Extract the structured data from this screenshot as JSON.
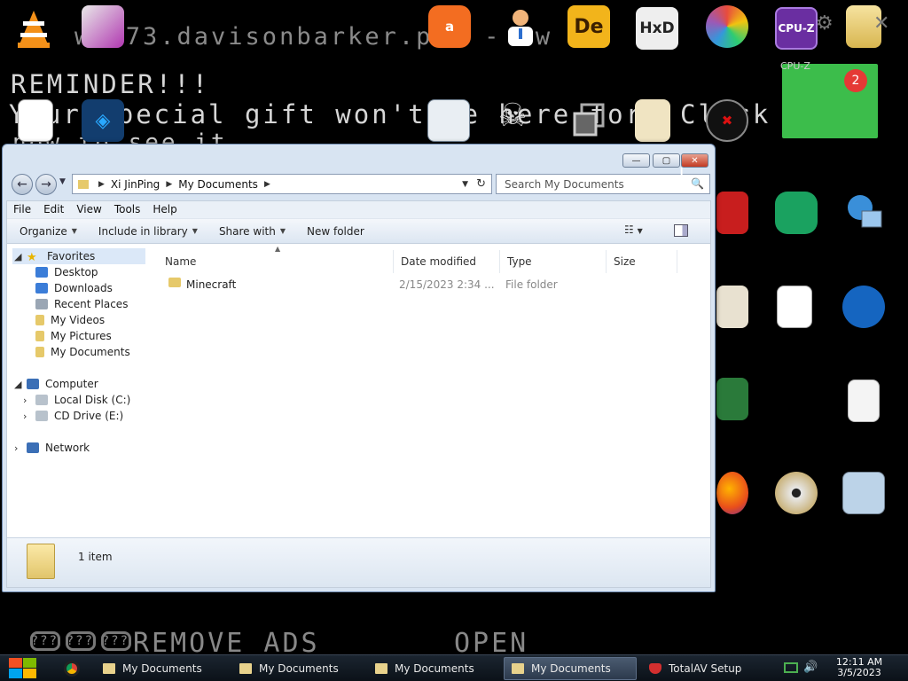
{
  "background": {
    "line1": "www73.davisonbarker.pro - ow",
    "line2": "REMINDER!!!",
    "line3": "Your special gift won't be here for! Click",
    "line4": "now to see it",
    "ads_text": "REMOVE ADS",
    "open_text": "OPEN",
    "qmarks": [
      "???",
      "???",
      "???"
    ]
  },
  "desktop": {
    "cpuz_label": "CPU-Z",
    "de_label": "De",
    "hxd_label": "HxD",
    "whatsapp_badge": "2",
    "whatsapp_label": "CPU-Z"
  },
  "window": {
    "caption": {
      "min": "—",
      "max": "▢",
      "close": "✕"
    },
    "breadcrumb": [
      "Xi JinPing",
      "My Documents"
    ],
    "search_placeholder": "Search My Documents",
    "menu": [
      "File",
      "Edit",
      "View",
      "Tools",
      "Help"
    ],
    "toolbar": {
      "organize": "Organize",
      "include": "Include in library",
      "share": "Share with",
      "new_folder": "New folder"
    },
    "nav": {
      "favorites": "Favorites",
      "desktop": "Desktop",
      "downloads": "Downloads",
      "recent": "Recent Places",
      "videos": "My Videos",
      "pictures": "My Pictures",
      "documents": "My Documents",
      "computer": "Computer",
      "local_disk": "Local Disk (C:)",
      "cd_drive": "CD Drive (E:)",
      "network": "Network"
    },
    "columns": {
      "name": "Name",
      "date": "Date modified",
      "type": "Type",
      "size": "Size"
    },
    "files": [
      {
        "name": "Minecraft",
        "date": "2/15/2023 2:34 ...",
        "type": "File folder",
        "size": ""
      }
    ],
    "status": "1 item"
  },
  "taskbar": {
    "buttons": [
      "My Documents",
      "My Documents",
      "My Documents",
      "My Documents",
      "TotalAV Setup"
    ],
    "time": "12:11 AM",
    "date": "3/5/2023"
  },
  "colors": {
    "accent": "#1f5fa8",
    "close_red": "#c23a22",
    "taskbar": "#0b1118"
  }
}
